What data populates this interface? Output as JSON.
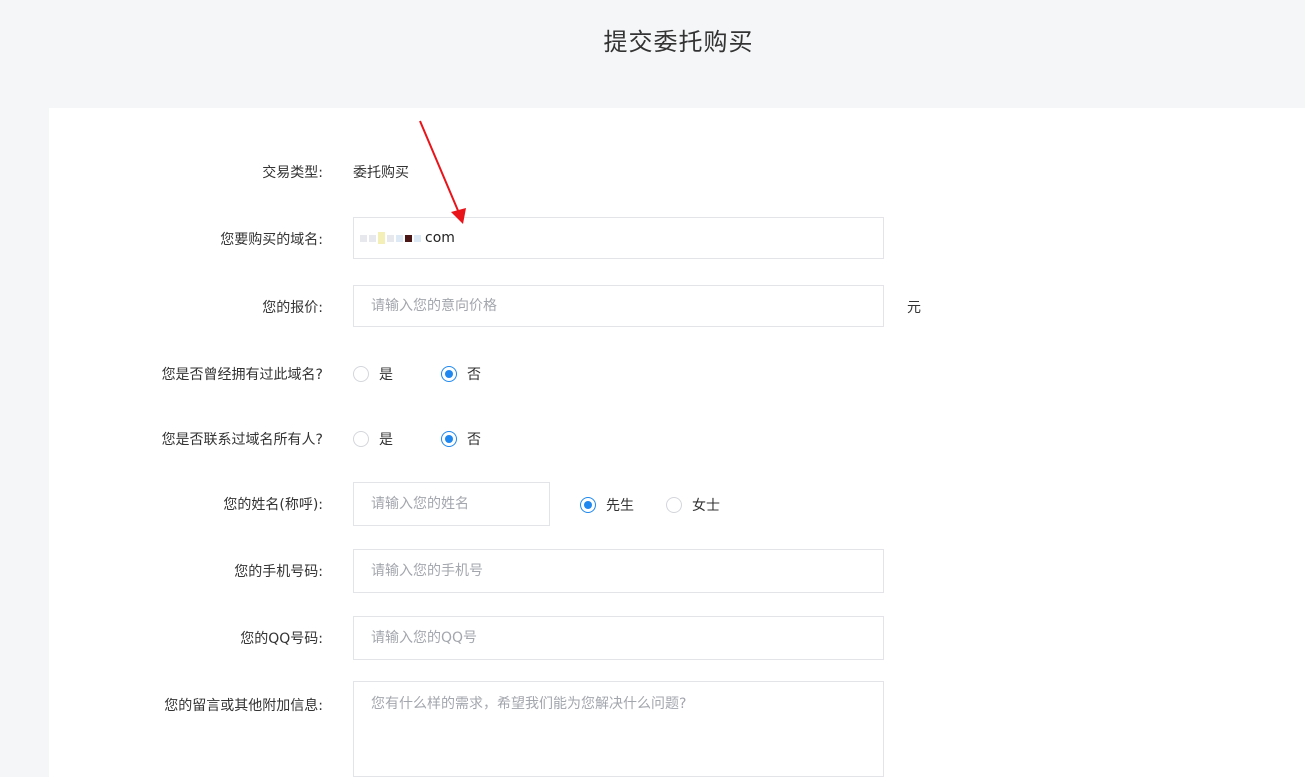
{
  "page": {
    "title": "提交委托购买"
  },
  "form": {
    "trade_type": {
      "label": "交易类型:",
      "value": "委托购买"
    },
    "domain": {
      "label": "您要购买的域名:",
      "value_suffix": "com"
    },
    "price": {
      "label": "您的报价:",
      "placeholder": "请输入您的意向价格",
      "unit": "元"
    },
    "owned_before": {
      "label": "您是否曾经拥有过此域名?",
      "options": [
        "是",
        "否"
      ],
      "selected": "否"
    },
    "contacted_owner": {
      "label": "您是否联系过域名所有人?",
      "options": [
        "是",
        "否"
      ],
      "selected": "否"
    },
    "name": {
      "label": "您的姓名(称呼):",
      "placeholder": "请输入您的姓名",
      "options": [
        "先生",
        "女士"
      ],
      "selected": "先生"
    },
    "phone": {
      "label": "您的手机号码:",
      "placeholder": "请输入您的手机号"
    },
    "qq": {
      "label": "您的QQ号码:",
      "placeholder": "请输入您的QQ号"
    },
    "message": {
      "label": "您的留言或其他附加信息:",
      "placeholder": "您有什么样的需求，希望我们能为您解决什么问题?"
    }
  },
  "colors": {
    "accent": "#1e88f0",
    "annotation_arrow": "#e8141a"
  }
}
